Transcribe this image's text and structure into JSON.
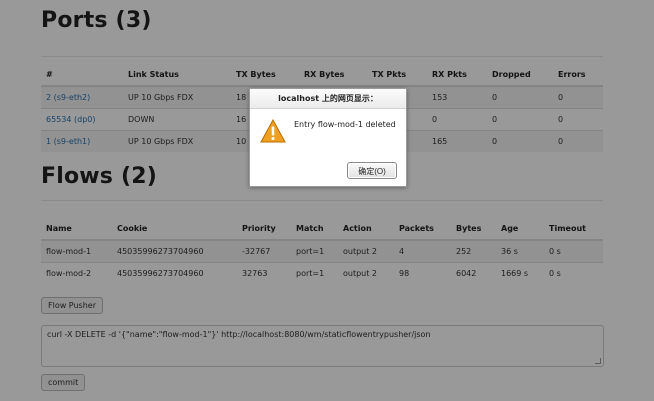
{
  "ports": {
    "title": "Ports (3)",
    "headers": [
      "#",
      "Link Status",
      "TX Bytes",
      "RX Bytes",
      "TX Pkts",
      "RX Pkts",
      "Dropped",
      "Errors"
    ],
    "rows": [
      [
        "2 (s9-eth2)",
        "UP 10 Gbps FDX",
        "18",
        "",
        "",
        "153",
        "0",
        "0"
      ],
      [
        "65534 (dp0)",
        "DOWN",
        "16",
        "",
        "",
        "0",
        "0",
        "0"
      ],
      [
        "1 (s9-eth1)",
        "UP 10 Gbps FDX",
        "10",
        "",
        "",
        "165",
        "0",
        "0"
      ]
    ]
  },
  "flows": {
    "title": "Flows (2)",
    "headers": [
      "Name",
      "Cookie",
      "Priority",
      "Match",
      "Action",
      "Packets",
      "Bytes",
      "Age",
      "Timeout"
    ],
    "rows": [
      [
        "flow-mod-1",
        "45035996273704960",
        "-32767",
        "port=1",
        "output 2",
        "4",
        "252",
        "36 s",
        "0 s"
      ],
      [
        "flow-mod-2",
        "45035996273704960",
        "32763",
        "port=1",
        "output 2",
        "98",
        "6042",
        "1669 s",
        "0 s"
      ]
    ]
  },
  "flow_pusher": {
    "button_label": "Flow Pusher",
    "command": "curl -X DELETE -d '{\"name\":\"flow-mod-1\"}' http://localhost:8080/wm/staticflowentrypusher/json",
    "commit_label": "commit"
  },
  "dialog": {
    "title": "localhost 上的网页显示：",
    "message": "Entry flow-mod-1 deleted",
    "ok_label": "确定(O)",
    "icon": "warning-icon"
  },
  "colors": {
    "link": "#2a6fa8",
    "warning_fill": "#f0a020",
    "overlay": "rgba(0,0,0,0.40)"
  }
}
